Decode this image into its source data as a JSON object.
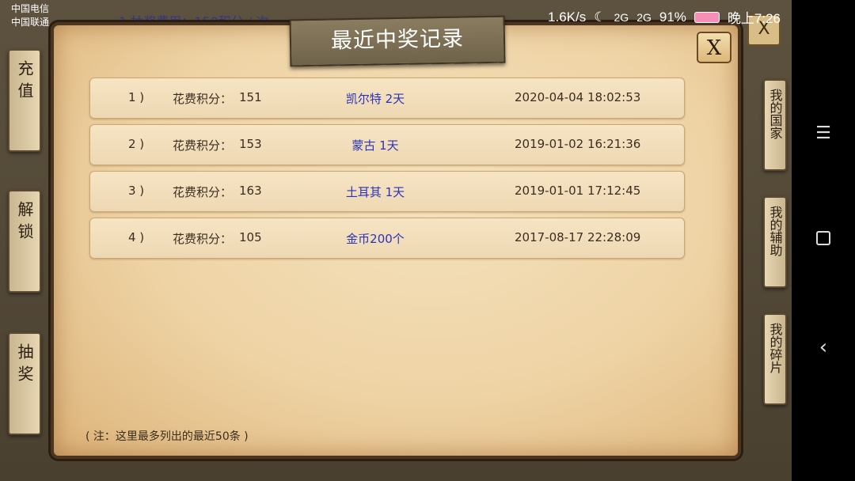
{
  "status_bar": {
    "carrier_1": "中国电信",
    "carrier_2": "中国联通",
    "speed": "1.6K/s",
    "network_1": "2G",
    "network_2": "2G",
    "battery": "91%",
    "time": "晚上7:26"
  },
  "background": {
    "title_fragment": "1 抽奖费用：150积分 / 次",
    "close_label": "X",
    "left_tabs": [
      {
        "label": "充值"
      },
      {
        "label": "解锁"
      },
      {
        "label": "抽奖"
      }
    ],
    "right_tabs": [
      {
        "label": "我的国家"
      },
      {
        "label": "我的辅助"
      },
      {
        "label": "我的碎片"
      }
    ]
  },
  "popup": {
    "title": "最近中奖记录",
    "close_label": "X",
    "points_label": "花费积分：",
    "records": [
      {
        "index": "1 )",
        "points": "151",
        "prize": "凯尔特 2天",
        "time": "2020-04-04 18:02:53"
      },
      {
        "index": "2 )",
        "points": "153",
        "prize": "蒙古 1天",
        "time": "2019-01-02 16:21:36"
      },
      {
        "index": "3 )",
        "points": "163",
        "prize": "土耳其 1天",
        "time": "2019-01-01 17:12:45"
      },
      {
        "index": "4 )",
        "points": "105",
        "prize": "金币200个",
        "time": "2017-08-17 22:28:09"
      }
    ],
    "note": "( 注：这里最多列出的最近50条 )"
  },
  "colors": {
    "prize_text": "#2b33b8",
    "parchment": "#f0d8ac",
    "frame": "#4b3520"
  }
}
